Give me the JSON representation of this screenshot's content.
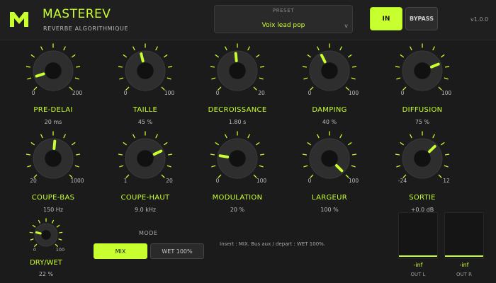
{
  "header": {
    "title": "MASTEREV",
    "subtitle": "REVERBE ALGORITHMIQUE",
    "preset_label": "PRESET",
    "preset_value": "Voix lead pop",
    "in_label": "IN",
    "bypass_label": "BYPASS",
    "version": "v1.0.0"
  },
  "colors": {
    "accent": "#c8ff2e",
    "background": "#1b1b1b",
    "knob_body": "#2d2d2d"
  },
  "icons": {
    "logo": "m-logo-icon",
    "preset_chevron": "chevron-down-icon"
  },
  "knobs": [
    {
      "name": "PRE-DELAI",
      "value": "20 ms",
      "min": "0",
      "max": "200",
      "fraction": 0.1
    },
    {
      "name": "TAILLE",
      "value": "45 %",
      "min": "0",
      "max": "100",
      "fraction": 0.45
    },
    {
      "name": "DECROISSANCE",
      "value": "1.80 s",
      "min": "0",
      "max": "20",
      "fraction": 0.48
    },
    {
      "name": "DAMPING",
      "value": "40 %",
      "min": "0",
      "max": "100",
      "fraction": 0.4
    },
    {
      "name": "DIFFUSION",
      "value": "75 %",
      "min": "0",
      "max": "100",
      "fraction": 0.75
    },
    {
      "name": "COUPE-BAS",
      "value": "150 Hz",
      "min": "20",
      "max": "1000",
      "fraction": 0.52
    },
    {
      "name": "COUPE-HAUT",
      "value": "9.0 kHz",
      "min": "1",
      "max": "20",
      "fraction": 0.74
    },
    {
      "name": "MODULATION",
      "value": "20 %",
      "min": "0",
      "max": "100",
      "fraction": 0.2
    },
    {
      "name": "LARGEUR",
      "value": "100 %",
      "min": "0",
      "max": "100",
      "fraction": 1.0
    },
    {
      "name": "SORTIE",
      "value": "+0.0 dB",
      "min": "-24",
      "max": "12",
      "fraction": 0.67
    }
  ],
  "drywet": {
    "name": "DRY/WET",
    "value": "22 %",
    "min": "0",
    "max": "100",
    "fraction": 0.22
  },
  "mode": {
    "label": "MODE",
    "mix_label": "MIX",
    "wet_label": "WET 100%",
    "selected": "MIX"
  },
  "hint": "Insert : MIX. Bus aux / depart : WET 100%.",
  "meters": [
    {
      "label": "OUT L",
      "value": "-inf"
    },
    {
      "label": "OUT R",
      "value": "-inf"
    }
  ]
}
